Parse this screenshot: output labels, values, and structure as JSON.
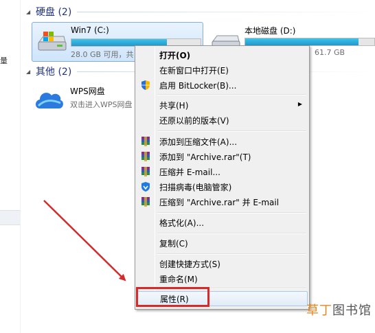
{
  "groups": {
    "hard_disks": "硬盘 (2)",
    "other": "其他 (2)"
  },
  "drives": [
    {
      "name": "Win7 (C:)",
      "space": "28.0 GB 可用，共",
      "fill": 0.74,
      "selected": true
    },
    {
      "name": "本地磁盘 (D:)",
      "space": "61.7 GB",
      "fill": 0.88,
      "selected": false
    }
  ],
  "wps_drive": {
    "name": "WPS网盘",
    "desc": "双击进入WPS网盘"
  },
  "context_menu": {
    "items": [
      {
        "label": "打开(O)",
        "bold": true,
        "icon": ""
      },
      {
        "label": "在新窗口中打开(E)",
        "icon": ""
      },
      {
        "label": "启用 BitLocker(B)...",
        "icon": "shield-icon"
      },
      {
        "label": "共享(H)",
        "icon": "",
        "submenu": true
      },
      {
        "label": "还原以前的版本(V)",
        "icon": ""
      },
      {
        "label": "添加到压缩文件(A)...",
        "icon": "winrar-icon"
      },
      {
        "label": "添加到 \"Archive.rar\"(T)",
        "icon": "winrar-icon"
      },
      {
        "label": "压缩并 E-mail...",
        "icon": "winrar-icon"
      },
      {
        "label": "扫描病毒(电脑管家)",
        "icon": "pc-manager-shield-icon"
      },
      {
        "label": "压缩到 \"Archive.rar\" 并 E-mail",
        "icon": "winrar-icon"
      },
      {
        "label": "格式化(A)...",
        "icon": ""
      },
      {
        "label": "复制(C)",
        "icon": ""
      },
      {
        "label": "创建快捷方式(S)",
        "icon": ""
      },
      {
        "label": "重命名(M)",
        "icon": ""
      },
      {
        "label": "属性(R)",
        "icon": "",
        "highlighted": true
      }
    ]
  },
  "watermark": {
    "accent": "草丁",
    "rest": "图书馆"
  },
  "colors": {
    "accent_red": "#d42a2a",
    "selection_blue": "#84acdd",
    "menu_bg": "#f0f0f0",
    "group_title": "#1e3287"
  }
}
